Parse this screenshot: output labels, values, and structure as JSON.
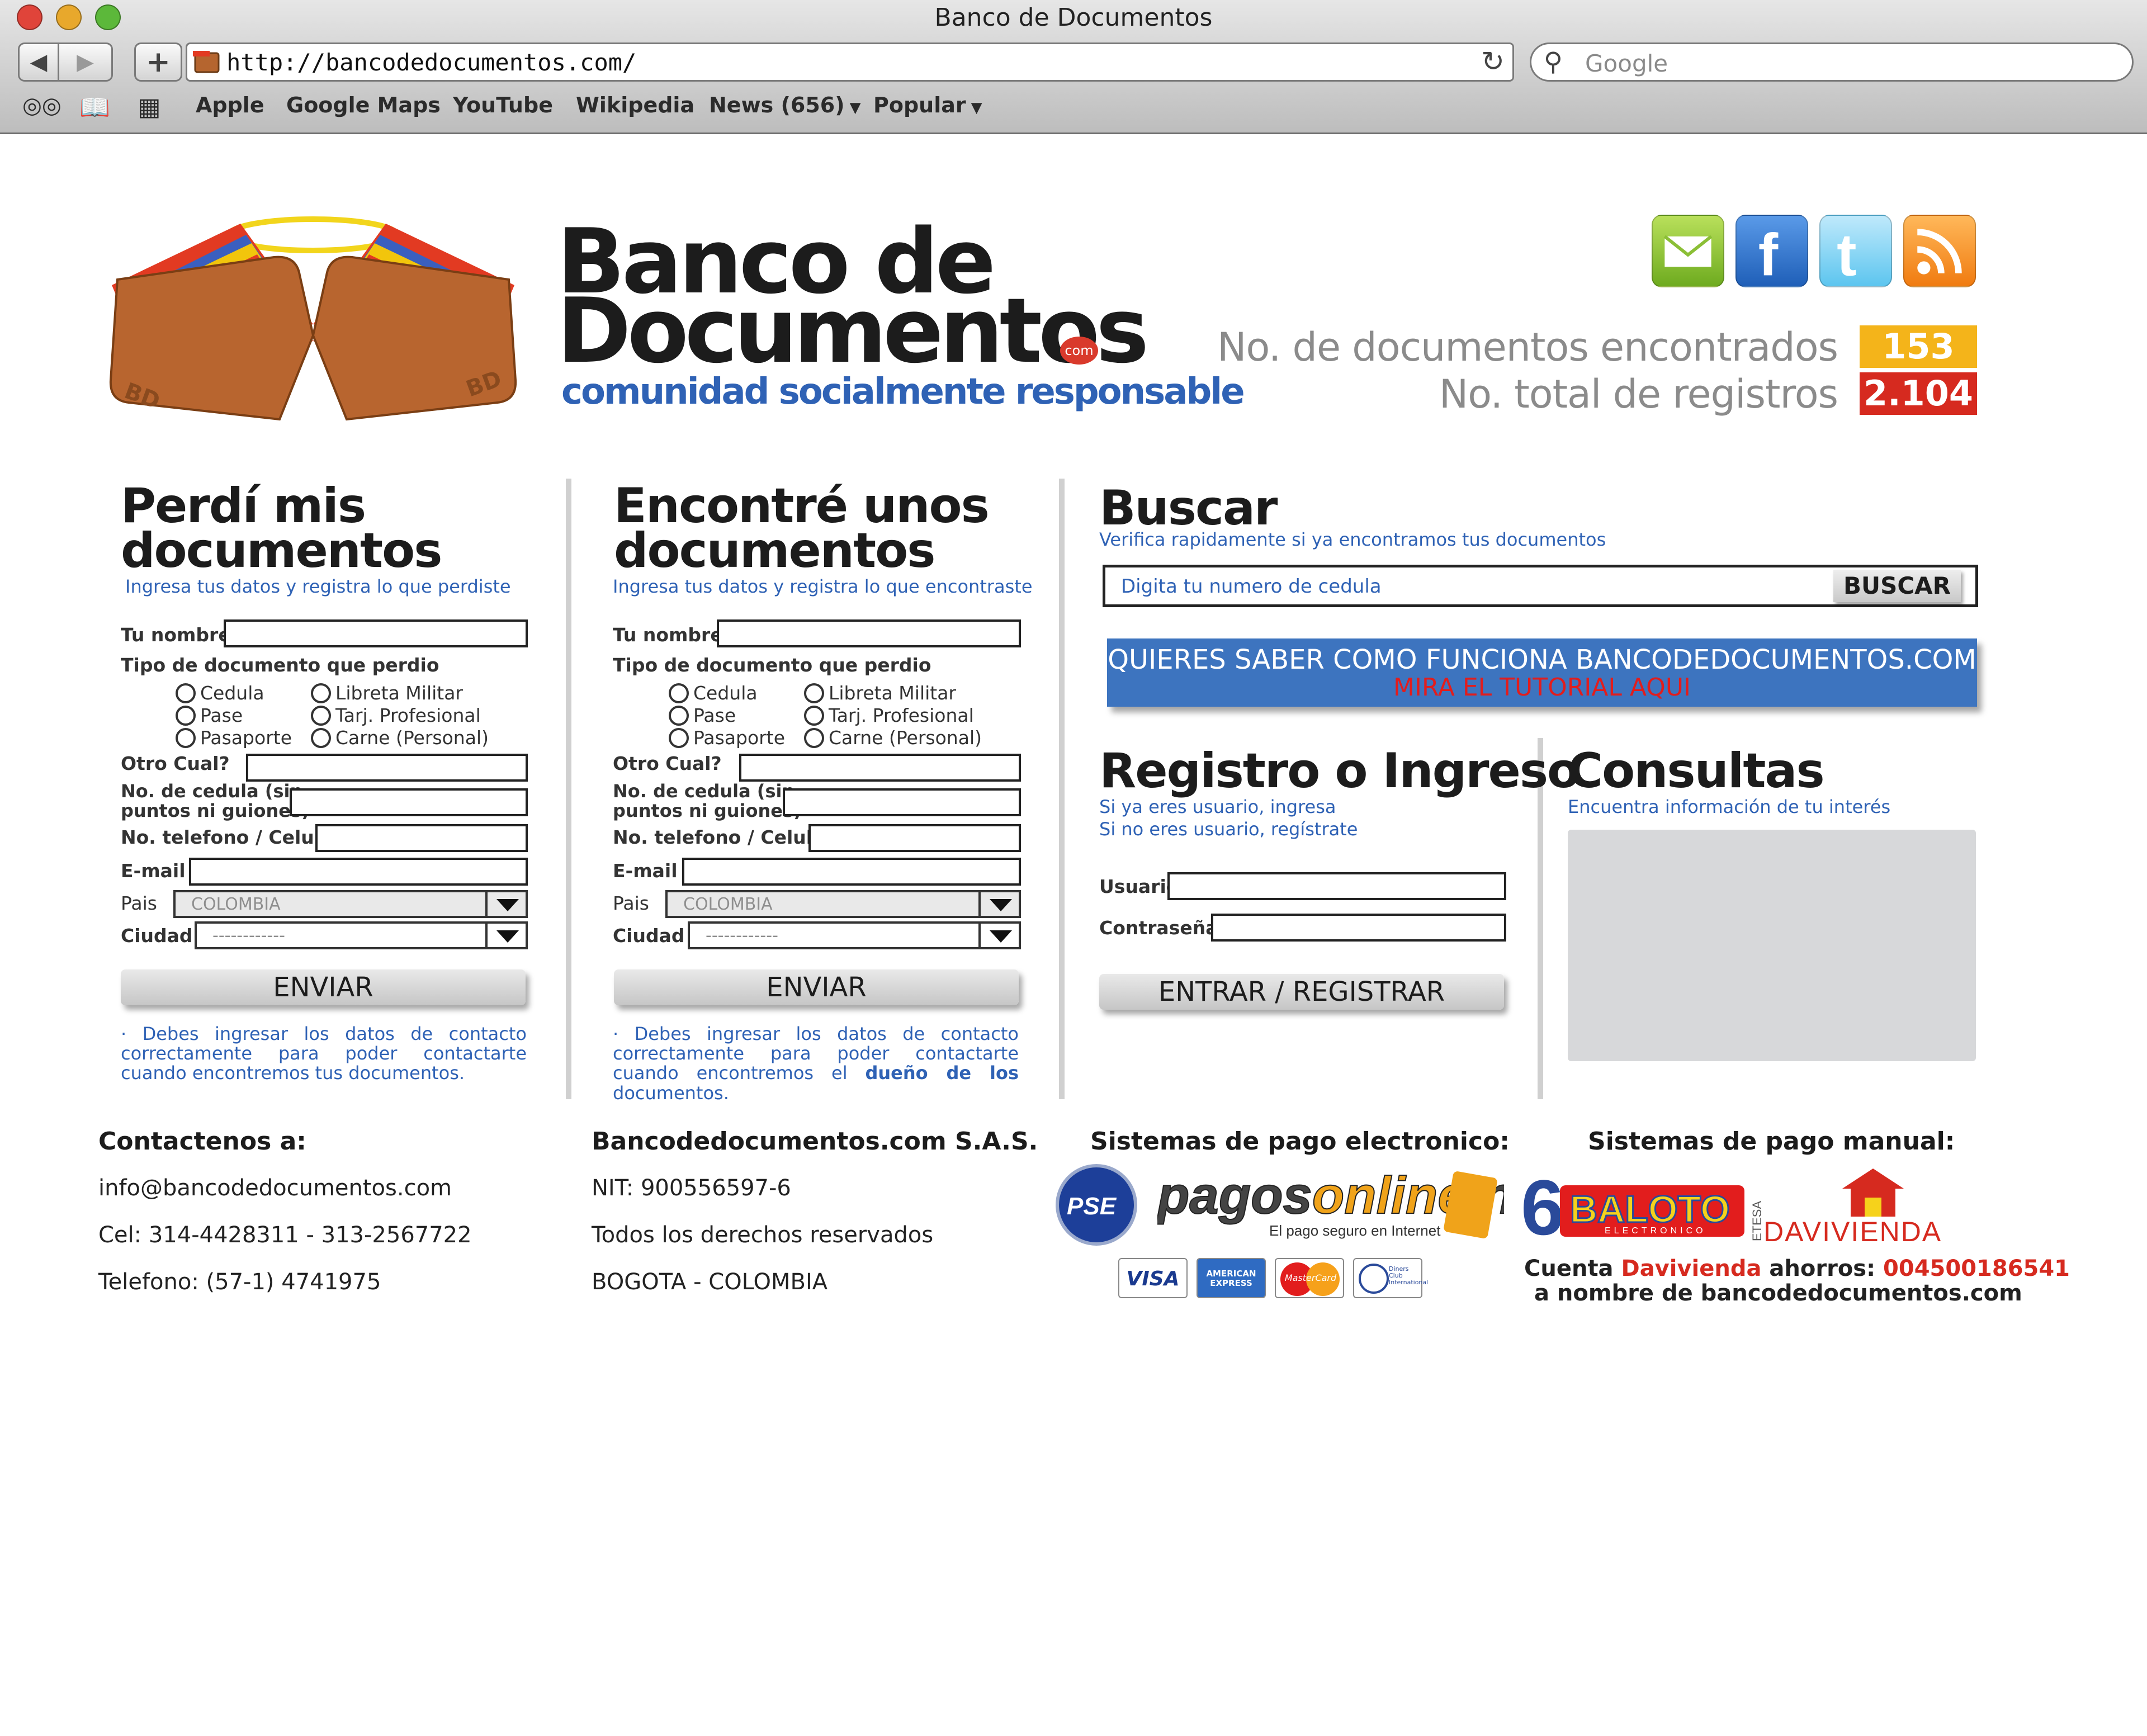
{
  "browser": {
    "window_title": "Banco de Documentos",
    "url": "http://bancodedocumentos.com/",
    "search_placeholder": "Google",
    "bookmarks": [
      "Apple",
      "Google Maps",
      "YouTube",
      "Wikipedia",
      "News (656)",
      "Popular"
    ]
  },
  "header": {
    "logo_line1": "Banco de",
    "logo_line2": "Documentos",
    "logo_com": "com",
    "tagline": "comunidad socialmente responsable",
    "logo_badge": "BD",
    "stats": [
      {
        "label": "No. de documentos encontrados",
        "value": "153",
        "color": "#f4b41a"
      },
      {
        "label": "No. total de registros",
        "value": "2.104",
        "color": "#d62a1f"
      }
    ],
    "social_icons": [
      "mail-icon",
      "facebook-icon",
      "twitter-icon",
      "rss-icon"
    ]
  },
  "lost": {
    "title_line1": "Perdí mis",
    "title_line2": "documentos",
    "subtitle": "Ingresa tus datos y registra lo que perdiste",
    "note": "· Debes ingresar los datos de contacto correctamente para poder contactarte cuando encontremos tus documentos."
  },
  "found": {
    "title_line1": "Encontré unos",
    "title_line2": "documentos",
    "subtitle": "Ingresa tus datos y registra lo que encontraste",
    "note_a": "· Debes ingresar los datos de contacto correctamente para poder contactarte cuando encontremos el ",
    "note_b": "dueño de los",
    "note_c": " documentos."
  },
  "form": {
    "nombre": "Tu nombre",
    "tipo": "Tipo de documento que perdio",
    "doc_types": [
      "Cedula",
      "Pase",
      "Pasaporte",
      "Libreta Militar",
      "Tarj. Profesional",
      "Carne (Personal)"
    ],
    "otro": "Otro Cual?",
    "cedula_line1": "No. de cedula (sin",
    "cedula_line2": "puntos ni guiones)",
    "telefono": "No. telefono / Celular",
    "email": "E-mail",
    "pais": "Pais",
    "pais_value": "COLOMBIA",
    "ciudad": "Ciudad",
    "ciudad_value": "------------",
    "submit": "ENVIAR"
  },
  "search": {
    "title": "Buscar",
    "subtitle": "Verifica rapidamente si ya encontramos tus documentos",
    "input_placeholder": "Digita tu numero de cedula",
    "button": "BUSCAR",
    "tutorial_line1": "QUIERES SABER COMO FUNCIONA BANCODEDOCUMENTOS.COM",
    "tutorial_line2": "MIRA EL TUTORIAL AQUI"
  },
  "login": {
    "title": "Registro o Ingreso",
    "sub1": "Si ya eres usuario, ingresa",
    "sub2": "Si no eres usuario, regístrate",
    "user_label": "Usuario",
    "pass_label": "Contraseña",
    "button": "ENTRAR / REGISTRAR"
  },
  "consultas": {
    "title": "Consultas",
    "subtitle": "Encuentra información de tu interés"
  },
  "footer": {
    "contact_head": "Contactenos a:",
    "contact_lines": [
      "info@bancodedocumentos.com",
      "Cel: 314-4428311 - 313-2567722",
      "Telefono: (57-1) 4741975"
    ],
    "company_head": "Bancodedocumentos.com S.A.S.",
    "company_lines": [
      "NIT: 900556597-6",
      "Todos los derechos reservados",
      "BOGOTA - COLOMBIA"
    ],
    "electronic_head": "Sistemas de pago electronico:",
    "manual_head": "Sistemas de pago manual:",
    "pse": "PSE",
    "pagosonline_a": "pagos",
    "pagosonline_b": "online",
    "pagosonline_c": ".net",
    "pagosonline_sub": "El pago seguro en Internet",
    "cards": [
      "VISA",
      "AMERICAN EXPRESS",
      "MasterCard",
      "Diners Club International"
    ],
    "baloto_6": "6",
    "baloto": "BALOTO",
    "baloto_sub": "ELECTRONICO",
    "baloto_side": "ETESA",
    "davivienda": "DAVIVIENDA",
    "cuenta_a": "Cuenta ",
    "cuenta_b": "Davivienda",
    "cuenta_c": " ahorros: ",
    "cuenta_d": "004500186541",
    "nombre": "a nombre de bancodedocumentos.com"
  }
}
